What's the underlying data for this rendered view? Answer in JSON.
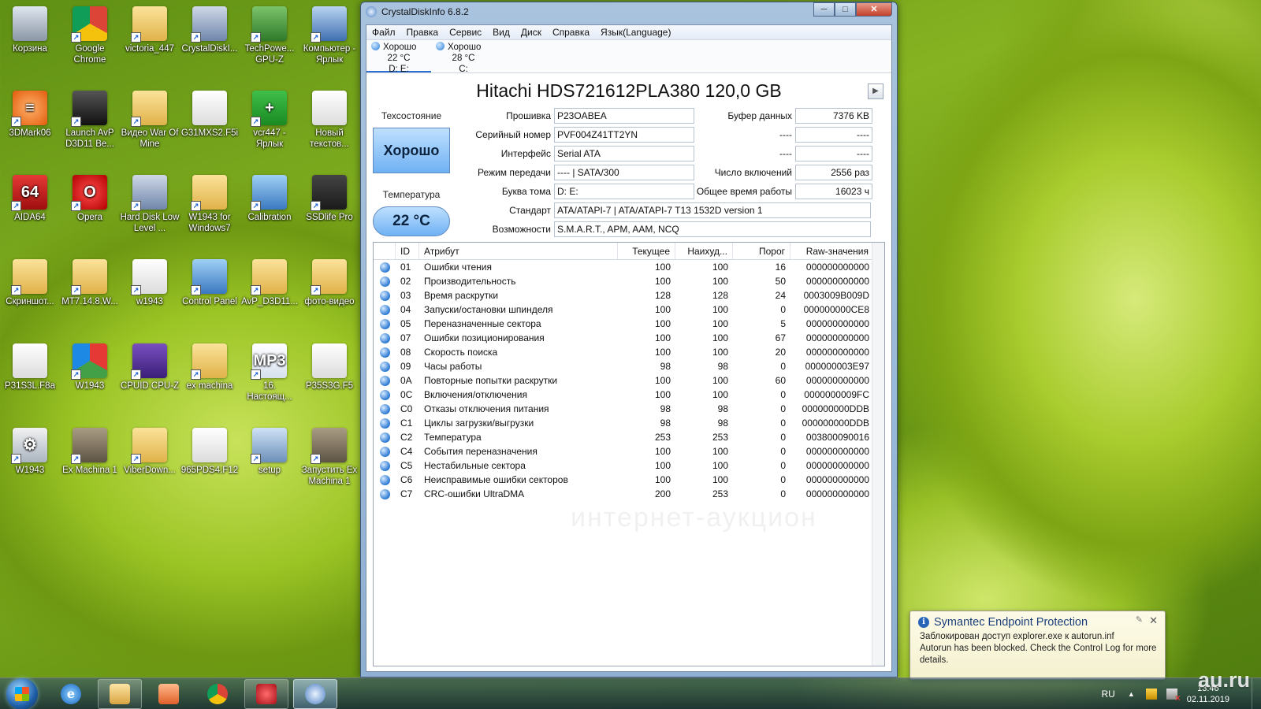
{
  "desktop": {
    "icons": [
      {
        "label": "Корзина",
        "icon": "recycle-bin-icon"
      },
      {
        "label": "Google Chrome",
        "icon": "chrome-icon"
      },
      {
        "label": "victoria_447",
        "icon": "folder-icon"
      },
      {
        "label": "CrystalDiskI...",
        "icon": "crystaldisk-icon"
      },
      {
        "label": "TechPowe... GPU-Z",
        "icon": "gpu-z-icon"
      },
      {
        "label": "Компьютер - Ярлык",
        "icon": "computer-icon"
      },
      {
        "label": "3DMark06",
        "icon": "3dmark-icon"
      },
      {
        "label": "Launch AvP D3D11 Be...",
        "icon": "avp-icon"
      },
      {
        "label": "Видео War Of Mine",
        "icon": "folder-icon"
      },
      {
        "label": "G31MXS2.F5i",
        "icon": "file-icon"
      },
      {
        "label": "vcr447 - Ярлык",
        "icon": "vcr-icon"
      },
      {
        "label": "Новый текстов...",
        "icon": "text-file-icon"
      },
      {
        "label": "AIDA64",
        "icon": "aida64-icon"
      },
      {
        "label": "Opera",
        "icon": "opera-icon"
      },
      {
        "label": "Hard Disk Low Level ...",
        "icon": "hdd-format-icon"
      },
      {
        "label": "W1943 for Windows7",
        "icon": "zip-folder-icon"
      },
      {
        "label": "Calibration",
        "icon": "calibration-icon"
      },
      {
        "label": "SSDlife Pro",
        "icon": "ssdlife-icon"
      },
      {
        "label": "Скриншот...",
        "icon": "folder-icon"
      },
      {
        "label": "MT7.14.8.W...",
        "icon": "zip-folder-icon"
      },
      {
        "label": "w1943",
        "icon": "installer-icon"
      },
      {
        "label": "Control Panel",
        "icon": "control-panel-icon"
      },
      {
        "label": "AvP_D3D11...",
        "icon": "zip-folder-icon"
      },
      {
        "label": "фото-видео",
        "icon": "folder-icon"
      },
      {
        "label": "P31S3L.F8a",
        "icon": "file-icon"
      },
      {
        "label": "W1943",
        "icon": "color-profile-icon"
      },
      {
        "label": "CPUID CPU-Z",
        "icon": "cpu-z-icon"
      },
      {
        "label": "ex machina",
        "icon": "zip-folder-icon"
      },
      {
        "label": "16. Настоящ...",
        "icon": "mp3-icon"
      },
      {
        "label": "P35S3G.F5",
        "icon": "file-icon"
      },
      {
        "label": "W1943",
        "icon": "settings-file-icon"
      },
      {
        "label": "Ex Machina 1",
        "icon": "ex-machina-icon"
      },
      {
        "label": "ViberDown...",
        "icon": "zip-folder-icon"
      },
      {
        "label": "965PDS4.F12",
        "icon": "file-icon"
      },
      {
        "label": "setup",
        "icon": "setup-icon"
      },
      {
        "label": "Запустить Ex Machina 1",
        "icon": "ex-machina-icon"
      }
    ]
  },
  "window": {
    "title": "CrystalDiskInfo 6.8.2",
    "min": "─",
    "max": "□",
    "close": "✕",
    "menu": [
      "Файл",
      "Правка",
      "Сервис",
      "Вид",
      "Диск",
      "Справка",
      "Язык(Language)"
    ],
    "drives": [
      {
        "status": "Хорошо",
        "temp": "22 °C",
        "letters": "D: E:"
      },
      {
        "status": "Хорошо",
        "temp": "28 °C",
        "letters": "C:"
      }
    ],
    "disk_title": "Hitachi HDS721612PLA380 120,0 GB",
    "next": "▶",
    "health_label": "Техсостояние",
    "health_value": "Хорошо",
    "temp_label": "Температура",
    "temp_value": "22 °C",
    "fields": {
      "firmware_label": "Прошивка",
      "firmware": "P23OABEA",
      "serial_label": "Серийный номер",
      "serial": "PVF004Z41TT2YN",
      "interface_label": "Интерфейс",
      "interface": "Serial ATA",
      "transfer_label": "Режим передачи",
      "transfer": "---- | SATA/300",
      "volume_label": "Буква тома",
      "volume": "D: E:",
      "standard_label": "Стандарт",
      "standard": "ATA/ATAPI-7 | ATA/ATAPI-7 T13 1532D version 1",
      "features_label": "Возможности",
      "features": "S.M.A.R.T., APM, AAM, NCQ",
      "buffer_label": "Буфер данных",
      "buffer": "7376 KB",
      "blank1_label": "----",
      "blank1": "----",
      "blank2_label": "----",
      "blank2": "----",
      "power_on_count_label": "Число включений",
      "power_on_count": "2556 раз",
      "power_on_hours_label": "Общее время работы",
      "power_on_hours": "16023 ч"
    },
    "smart_headers": [
      "ID",
      "Атрибут",
      "Текущее",
      "Наихуд...",
      "Порог",
      "Raw-значения"
    ],
    "smart_rows": [
      [
        "01",
        "Ошибки чтения",
        "100",
        "100",
        "16",
        "000000000000"
      ],
      [
        "02",
        "Производительность",
        "100",
        "100",
        "50",
        "000000000000"
      ],
      [
        "03",
        "Время раскрутки",
        "128",
        "128",
        "24",
        "0003009B009D"
      ],
      [
        "04",
        "Запуски/остановки шпинделя",
        "100",
        "100",
        "0",
        "000000000CE8"
      ],
      [
        "05",
        "Переназначенные сектора",
        "100",
        "100",
        "5",
        "000000000000"
      ],
      [
        "07",
        "Ошибки позиционирования",
        "100",
        "100",
        "67",
        "000000000000"
      ],
      [
        "08",
        "Скорость поиска",
        "100",
        "100",
        "20",
        "000000000000"
      ],
      [
        "09",
        "Часы работы",
        "98",
        "98",
        "0",
        "000000003E97"
      ],
      [
        "0A",
        "Повторные попытки раскрутки",
        "100",
        "100",
        "60",
        "000000000000"
      ],
      [
        "0C",
        "Включения/отключения",
        "100",
        "100",
        "0",
        "0000000009FC"
      ],
      [
        "C0",
        "Отказы отключения питания",
        "98",
        "98",
        "0",
        "000000000DDB"
      ],
      [
        "C1",
        "Циклы загрузки/выгрузки",
        "98",
        "98",
        "0",
        "000000000DDB"
      ],
      [
        "C2",
        "Температура",
        "253",
        "253",
        "0",
        "003800090016"
      ],
      [
        "C4",
        "События переназначения",
        "100",
        "100",
        "0",
        "000000000000"
      ],
      [
        "C5",
        "Нестабильные сектора",
        "100",
        "100",
        "0",
        "000000000000"
      ],
      [
        "C6",
        "Неисправимые ошибки секторов",
        "100",
        "100",
        "0",
        "000000000000"
      ],
      [
        "C7",
        "CRC-ошибки UltraDMA",
        "200",
        "253",
        "0",
        "000000000000"
      ]
    ],
    "watermark": "интернет-аукцион"
  },
  "notification": {
    "title": "Symantec Endpoint Protection",
    "info": "i",
    "pin": "✎",
    "close": "✕",
    "line1": "Заблокирован доступ explorer.exe к autorun.inf",
    "line2": "Autorun has been blocked. Check the Control Log for more details."
  },
  "taskbar": {
    "ie_letter": "e",
    "lang": "RU",
    "tray_arrow": "▲",
    "time": "13:46",
    "date": "02.11.2019"
  },
  "site_mark": "au.ru",
  "colors": {
    "good_status": "#6fb1f3",
    "accent": "#2e6fd0"
  }
}
